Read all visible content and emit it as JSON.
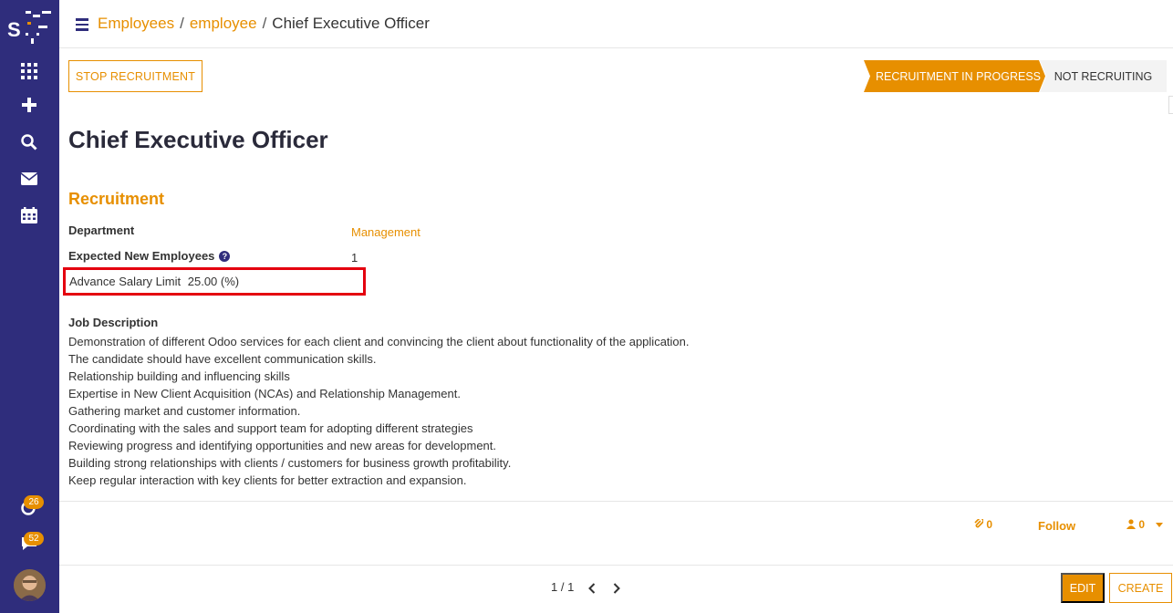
{
  "breadcrumb": {
    "items": [
      "Employees",
      "employee"
    ],
    "separator": "/",
    "current": "Chief Executive Officer"
  },
  "actions": {
    "stop_recruitment": "STOP RECRUITMENT"
  },
  "status": {
    "active": "RECRUITMENT IN PROGRESS",
    "inactive": "NOT RECRUITING"
  },
  "record": {
    "title": "Chief Executive Officer",
    "section": "Recruitment",
    "department_label": "Department",
    "department_value": "Management",
    "expected_label": "Expected New Employees",
    "expected_help": "?",
    "expected_value": "1",
    "salary_label": "Advance Salary Limit",
    "salary_value": "25.00 (%)",
    "jd_label": "Job Description",
    "jd_lines": [
      "Demonstration of different Odoo services for each client and convincing the client about functionality of the application.",
      "The candidate should have excellent communication skills.",
      "Relationship building and influencing skills",
      "Expertise in New Client Acquisition (NCAs) and Relationship Management.",
      "Gathering market and customer information.",
      "Coordinating with the sales and support team for adopting different strategies",
      "Reviewing progress and identifying opportunities and new areas for development.",
      "Building strong relationships with clients / customers for business growth profitability.",
      "Keep regular interaction with key clients for better extraction and expansion."
    ]
  },
  "chatter": {
    "attachments": "0",
    "follow": "Follow",
    "followers": "0"
  },
  "sidebar": {
    "badge_activities": "26",
    "badge_messages": "52"
  },
  "pager": {
    "text": "1 / 1"
  },
  "footer": {
    "edit": "EDIT",
    "create": "CREATE"
  },
  "colors": {
    "accent": "#e78f00",
    "sidebar": "#2f2d7c",
    "highlight": "#e4000f"
  }
}
